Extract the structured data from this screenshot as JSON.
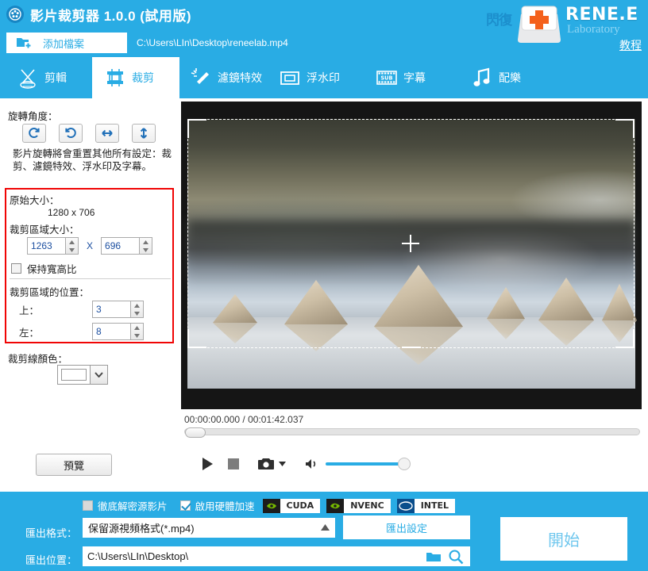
{
  "window": {
    "title": "影片裁剪器 1.0.0 (試用版)",
    "app_icon": "film-reel-icon",
    "accent_color": "#29ace4"
  },
  "brand": {
    "behind_text": "閃復",
    "name": "RENE.E",
    "sub": "Laboratory",
    "tutorial_link": "教程"
  },
  "file_row": {
    "add_button_label": "添加檔案",
    "add_button_icon": "add-file-icon",
    "file_path": "C:\\Users\\LIn\\Desktop\\reneelab.mp4"
  },
  "tabs": [
    {
      "label": "剪輯",
      "icon": "scissors-icon",
      "active": false
    },
    {
      "label": "裁剪",
      "icon": "crop-film-icon",
      "active": true
    },
    {
      "label": "濾鏡特效",
      "icon": "magic-wand-icon",
      "active": false
    },
    {
      "label": "浮水印",
      "icon": "watermark-frame-icon",
      "active": false
    },
    {
      "label": "字幕",
      "icon": "subtitle-sub-icon",
      "active": false
    },
    {
      "label": "配樂",
      "icon": "music-note-icon",
      "active": false
    }
  ],
  "left_panel": {
    "rotate_label": "旋轉角度：",
    "rotate_buttons": [
      {
        "name": "rotate-right-icon"
      },
      {
        "name": "rotate-left-icon"
      },
      {
        "name": "flip-horizontal-icon"
      },
      {
        "name": "flip-vertical-icon"
      }
    ],
    "rotate_hint": "影片旋轉將會重置其他所有設定：裁剪、濾鏡特效、浮水印及字幕。",
    "original_size_label": "原始大小：",
    "original_size_value": "1280 x 706",
    "crop_size_label": "裁剪區域大小：",
    "crop_width": "1263",
    "crop_height": "696",
    "size_separator": "X",
    "keep_ratio_label": "保持寬高比",
    "keep_ratio_checked": false,
    "crop_position_label": "裁剪區域的位置：",
    "top_label": "上：",
    "top_value": "3",
    "left_label": "左：",
    "left_value": "8",
    "line_color_label": "裁剪線顏色：",
    "line_color_value": "#ffffff",
    "preview_button": "預覽"
  },
  "player": {
    "current_time": "00:00:00.000",
    "time_separator": "/",
    "total_time": "00:01:42.037",
    "play_icon": "play-icon",
    "stop_icon": "stop-icon",
    "snapshot_icon": "camera-icon",
    "snapshot_dropdown_icon": "caret-down-icon",
    "volume_icon": "speaker-icon",
    "volume_percent": 100,
    "seek_percent": 0
  },
  "bottom_bar": {
    "decrypt_label": "徹底解密源影片",
    "decrypt_checked": false,
    "hwaccel_label": "啟用硬體加速",
    "hwaccel_checked": true,
    "badges": [
      {
        "label": "CUDA",
        "icon": "nvidia-icon"
      },
      {
        "label": "NVENC",
        "icon": "nvidia-icon"
      },
      {
        "label": "INTEL",
        "icon": "intel-icon"
      }
    ],
    "format_label": "匯出格式：",
    "format_value": "保留源視頻格式(*.mp4)",
    "export_settings_label": "匯出設定",
    "location_label": "匯出位置：",
    "location_value": "C:\\Users\\LIn\\Desktop\\",
    "folder_icon": "folder-icon",
    "search_icon": "search-icon",
    "start_label": "開始"
  }
}
